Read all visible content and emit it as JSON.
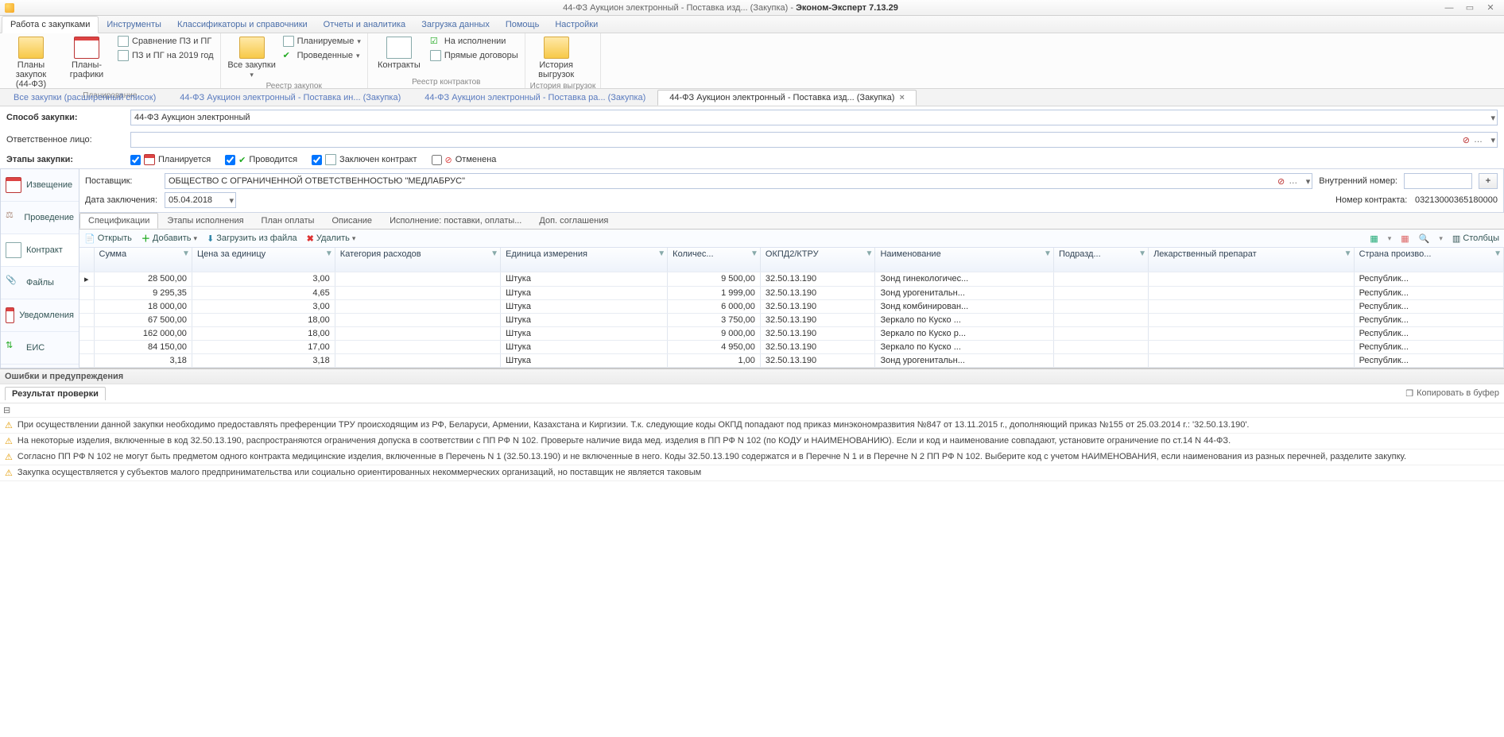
{
  "title_doc": "44-ФЗ Аукцион электронный - Поставка изд... (Закупка)",
  "title_app": "Эконом-Эксперт 7.13.29",
  "ribbon_tabs": [
    "Работа с закупками",
    "Инструменты",
    "Классификаторы и справочники",
    "Отчеты и аналитика",
    "Загрузка данных",
    "Помощь",
    "Настройки"
  ],
  "rg": {
    "plan": {
      "label": "Планирование",
      "plans": "Планы закупок\n(44-ФЗ)",
      "schedules": "Планы-графики",
      "cmp": "Сравнение ПЗ и ПГ",
      "year": "ПЗ и ПГ на 2019 год"
    },
    "reg": {
      "label": "Реестр закупок",
      "all": "Все закупки",
      "planned": "Планируемые",
      "done": "Проведенные"
    },
    "con": {
      "label": "Реестр контрактов",
      "contracts": "Контракты",
      "exec": "На исполнении",
      "direct": "Прямые договоры"
    },
    "hist": {
      "label": "История выгрузок",
      "btn": "История\nвыгрузок"
    }
  },
  "doctabs": [
    "Все закупки (расширенный список)",
    "44-ФЗ Аукцион электронный - Поставка  ин... (Закупка)",
    "44-ФЗ Аукцион электронный - Поставка  ра... (Закупка)",
    "44-ФЗ Аукцион электронный - Поставка изд... (Закупка)"
  ],
  "form": {
    "method_lbl": "Способ закупки:",
    "method_val": "44-ФЗ Аукцион электронный",
    "resp_lbl": "Ответственное лицо:",
    "stages_lbl": "Этапы закупки:",
    "st": {
      "plan": "Планируется",
      "run": "Проводится",
      "contract": "Заключен контракт",
      "cancel": "Отменена"
    }
  },
  "sidenav": {
    "notice": "Извещение",
    "proc": "Проведение",
    "contract": "Контракт",
    "files": "Файлы",
    "notif": "Уведомления",
    "eis": "ЕИС"
  },
  "contract": {
    "supplier_lbl": "Поставщик:",
    "supplier_val": "ОБЩЕСТВО С ОГРАНИЧЕННОЙ ОТВЕТСТВЕННОСТЬЮ \"МЕДЛАБРУС\"",
    "date_lbl": "Дата заключения:",
    "date_val": "05.04.2018",
    "intnum_lbl": "Внутренний номер:",
    "cnum_lbl": "Номер контракта:",
    "cnum_val": "03213000365180000"
  },
  "spectabs": [
    "Спецификации",
    "Этапы исполнения",
    "План оплаты",
    "Описание",
    "Исполнение: поставки, оплаты...",
    "Доп. соглашения"
  ],
  "toolbar": {
    "open": "Открыть",
    "add": "Добавить",
    "load": "Загрузить из файла",
    "del": "Удалить",
    "cols": "Столбцы"
  },
  "cols": [
    "Сумма",
    "Цена за единицу",
    "Категория расходов",
    "Единица измерения",
    "Количес...",
    "ОКПД2/КТРУ",
    "Наименование",
    "Подразд...",
    "Лекарственный препарат",
    "Страна произво..."
  ],
  "rows": [
    {
      "sum": "28 500,00",
      "price": "3,00",
      "cat": "",
      "unit": "Штука",
      "qty": "9 500,00",
      "okpd": "32.50.13.190",
      "name": "Зонд гинекологичес...",
      "sub": "",
      "med": "",
      "country": "Республик..."
    },
    {
      "sum": "9 295,35",
      "price": "4,65",
      "cat": "",
      "unit": "Штука",
      "qty": "1 999,00",
      "okpd": "32.50.13.190",
      "name": "Зонд урогенитальн...",
      "sub": "",
      "med": "",
      "country": "Республик..."
    },
    {
      "sum": "18 000,00",
      "price": "3,00",
      "cat": "",
      "unit": "Штука",
      "qty": "6 000,00",
      "okpd": "32.50.13.190",
      "name": "Зонд комбинирован...",
      "sub": "",
      "med": "",
      "country": "Республик..."
    },
    {
      "sum": "67 500,00",
      "price": "18,00",
      "cat": "",
      "unit": "Штука",
      "qty": "3 750,00",
      "okpd": "32.50.13.190",
      "name": "Зеркало  по Куско ...",
      "sub": "",
      "med": "",
      "country": "Республик..."
    },
    {
      "sum": "162 000,00",
      "price": "18,00",
      "cat": "",
      "unit": "Штука",
      "qty": "9 000,00",
      "okpd": "32.50.13.190",
      "name": "Зеркало  по Куско р...",
      "sub": "",
      "med": "",
      "country": "Республик..."
    },
    {
      "sum": "84 150,00",
      "price": "17,00",
      "cat": "",
      "unit": "Штука",
      "qty": "4 950,00",
      "okpd": "32.50.13.190",
      "name": "Зеркало  по Куско ...",
      "sub": "",
      "med": "",
      "country": "Республик..."
    },
    {
      "sum": "3,18",
      "price": "3,18",
      "cat": "",
      "unit": "Штука",
      "qty": "1,00",
      "okpd": "32.50.13.190",
      "name": "Зонд урогенитальн...",
      "sub": "",
      "med": "",
      "country": "Республик..."
    }
  ],
  "errors": {
    "title": "Ошибки и предупреждения",
    "tab": "Результат проверки",
    "copy": "Копировать в буфер",
    "msgs": [
      "При осуществлении данной закупки необходимо предоставлять преференции ТРУ происходящим из РФ, Беларуси, Армении, Казахстана и Киргизии. Т.к. следующие коды ОКПД попадают под приказ минэкономразвития №847 от 13.11.2015 г., дополняющий приказ №155 от 25.03.2014 г.: '32.50.13.190'.",
      "На некоторые изделия, включенные в код 32.50.13.190, распространяются ограничения допуска в соответствии с ПП РФ N 102. Проверьте наличие вида мед. изделия в ПП РФ N 102 (по КОДУ и НАИМЕНОВАНИЮ). Если и код и наименование совпадают, установите ограничение по ст.14 N 44-ФЗ.",
      "Согласно ПП РФ N 102 не могут быть предметом одного контракта медицинские изделия, включенные в Перечень N 1 (32.50.13.190) и не включенные в него. Коды 32.50.13.190 содержатся и в Перечне N 1 и в Перечне N 2 ПП РФ N 102. Выберите код с учетом НАИМЕНОВАНИЯ, если наименования из разных перечней, разделите закупку.",
      "Закупка осуществляется у субъектов малого предпринимательства или социально ориентированных некоммерческих организаций, но поставщик не является таковым"
    ]
  }
}
